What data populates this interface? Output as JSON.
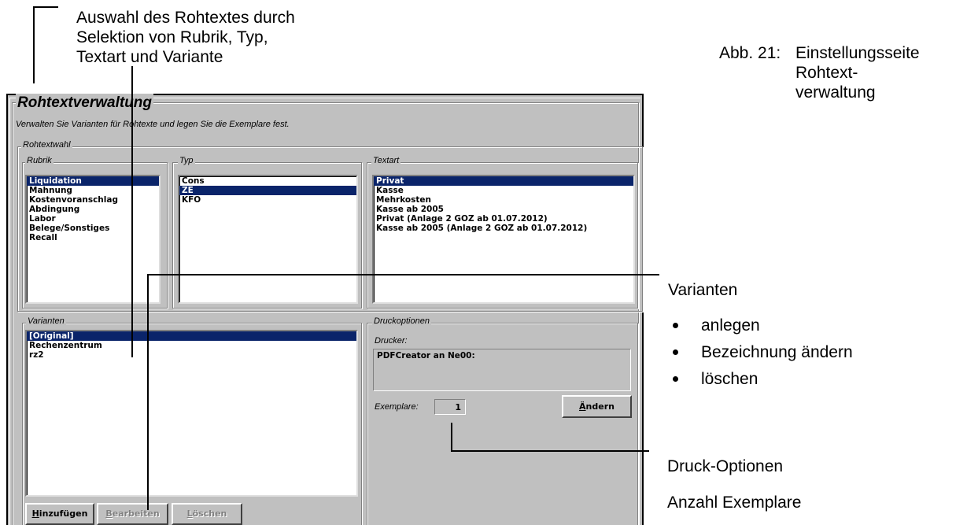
{
  "annotations": {
    "selection_caption": [
      "Auswahl des Rohtextes durch",
      "Selektion von Rubrik, Typ,",
      "Textart und Variante"
    ],
    "figure_number": "Abb. 21:",
    "figure_caption": [
      "Einstellungsseite",
      "Rohtext-",
      "verwaltung"
    ],
    "variants_title": "Varianten",
    "variants_bullets": [
      "anlegen",
      "Bezeichnung ändern",
      "löschen"
    ],
    "print_options": "Druck-Optionen",
    "copies_count": "Anzahl Exemplare"
  },
  "window": {
    "title": "Rohtextverwaltung",
    "subtitle": "Verwalten Sie Varianten für Rohtexte und legen Sie die Exemplare fest.",
    "rohtextwahl_label": "Rohtextwahl",
    "rubrik": {
      "label": "Rubrik",
      "items": [
        "Liquidation",
        "Mahnung",
        "Kostenvoranschlag",
        "Abdingung",
        "Labor",
        "Belege/Sonstiges",
        "Recall"
      ],
      "selected_index": 0
    },
    "typ": {
      "label": "Typ",
      "items": [
        "Cons",
        "ZE",
        "KFO"
      ],
      "selected_index": 1
    },
    "textart": {
      "label": "Textart",
      "items": [
        "Privat",
        "Kasse",
        "Mehrkosten",
        "Kasse ab 2005",
        "Privat (Anlage 2 GOZ ab 01.07.2012)",
        "Kasse ab 2005 (Anlage 2 GOZ ab 01.07.2012)"
      ],
      "selected_index": 0
    },
    "varianten": {
      "label": "Varianten",
      "items": [
        "[Original]",
        "Rechenzentrum",
        "rz2"
      ],
      "selected_index": 0
    },
    "druckoptionen": {
      "label": "Druckoptionen",
      "drucker_label": "Drucker:",
      "drucker_value": "PDFCreator an Ne00:",
      "exemplare_label": "Exemplare:",
      "exemplare_value": "1",
      "aendern_button": {
        "accel": "Ä",
        "rest": "ndern"
      }
    },
    "buttons": {
      "hinzufuegen": {
        "accel": "H",
        "rest": "inzufügen"
      },
      "bearbeiten": {
        "accel": "B",
        "rest": "earbeiten"
      },
      "loeschen": {
        "accel": "L",
        "rest": "öschen"
      }
    },
    "colors": {
      "selection": "#0a246a",
      "dialog_bg": "#c0c0c0"
    }
  }
}
